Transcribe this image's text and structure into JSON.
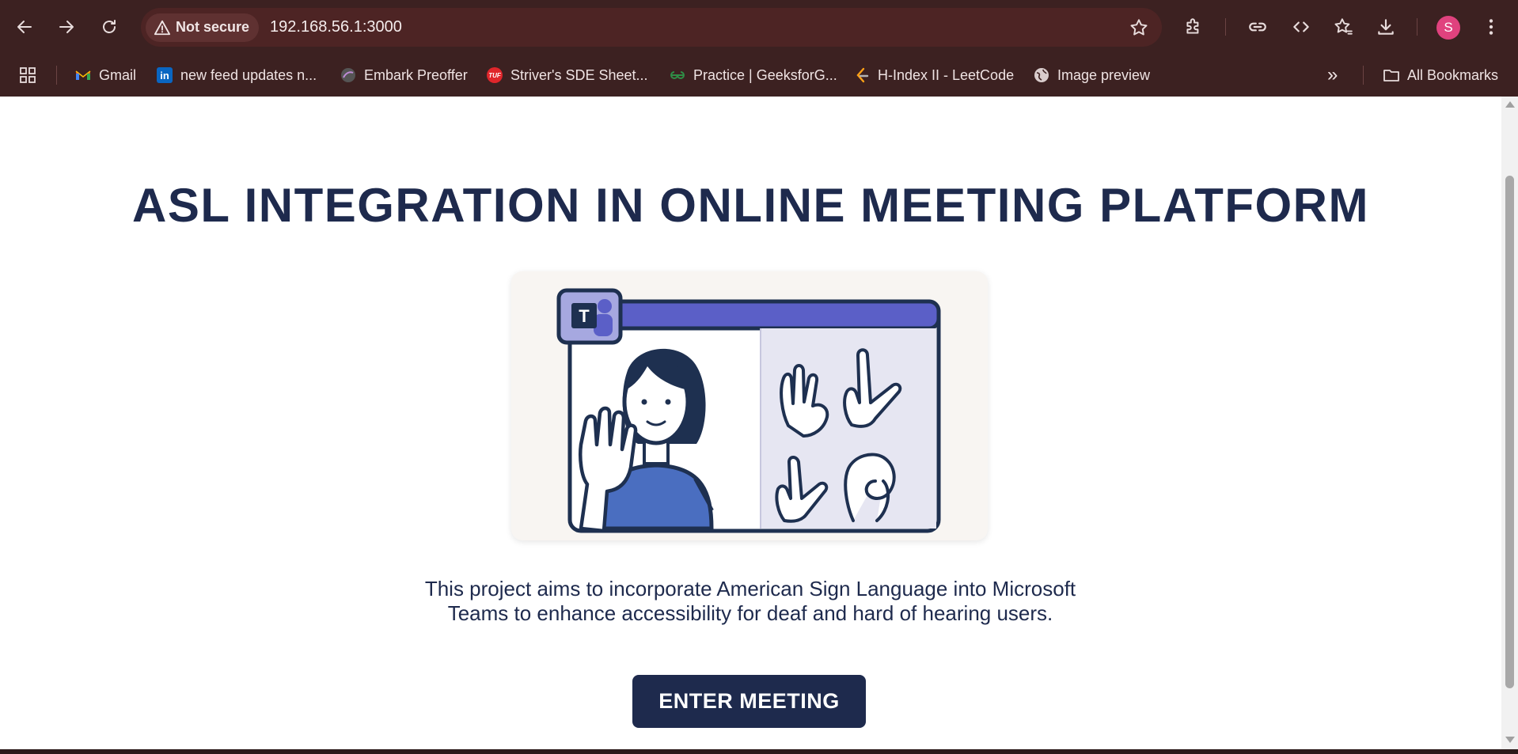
{
  "browser": {
    "security_label": "Not secure",
    "url": "192.168.56.1:3000",
    "profile_initial": "S"
  },
  "bookmarks": {
    "items": [
      {
        "label": "Gmail"
      },
      {
        "label": "new feed updates n..."
      },
      {
        "label": "Embark Preoffer"
      },
      {
        "label": "Striver's SDE Sheet..."
      },
      {
        "label": "Practice | GeeksforG..."
      },
      {
        "label": "H-Index II - LeetCode"
      },
      {
        "label": "Image preview"
      }
    ],
    "overflow_label": "»",
    "all_bookmarks_label": "All Bookmarks"
  },
  "page": {
    "title": "ASL INTEGRATION IN ONLINE MEETING PLATFORM",
    "description_line1": "This project aims to incorporate American Sign Language into Microsoft",
    "description_line2": "Teams to enhance accessibility for deaf and hard of hearing users.",
    "button_label": "ENTER MEETING",
    "teams_logo_letter": "T"
  },
  "colors": {
    "title_navy": "#1e2a4d",
    "browser_frame": "#3c2121",
    "teams_purple": "#5b5fc7",
    "shirt_blue": "#4a6ec0"
  }
}
